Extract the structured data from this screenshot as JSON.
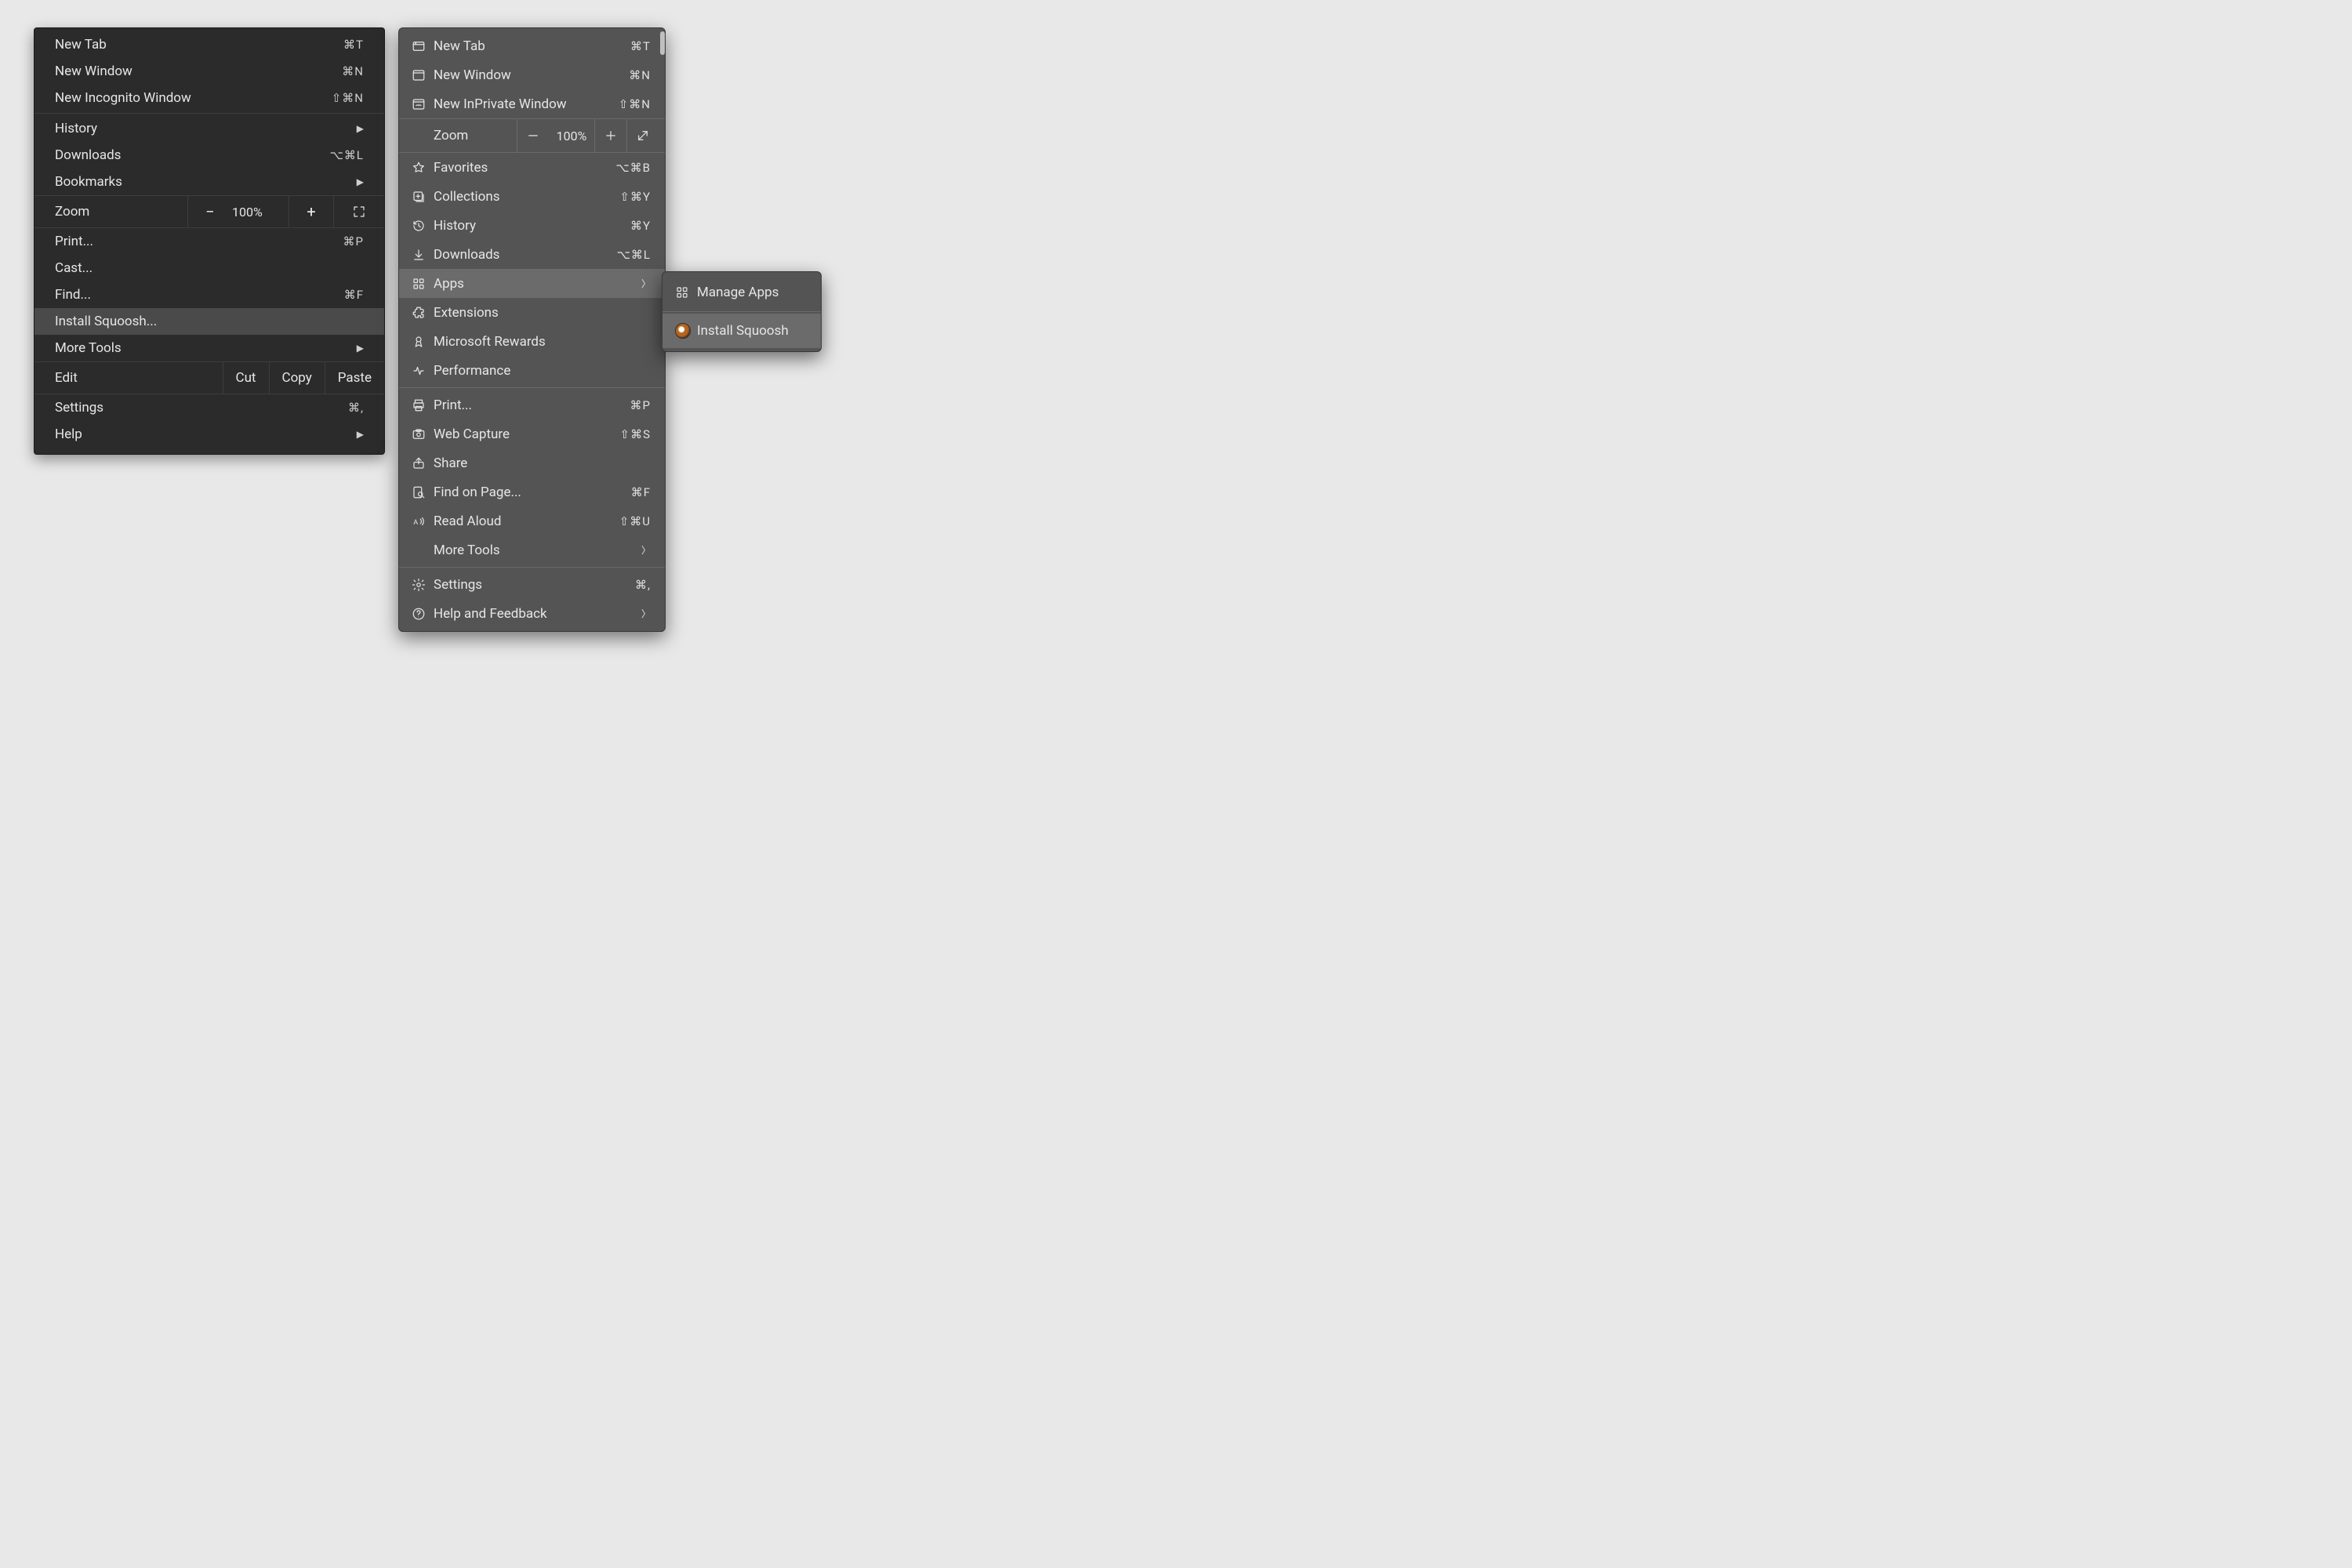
{
  "chrome_menu": {
    "sections": {
      "top": [
        {
          "label": "New Tab",
          "shortcut": "⌘T"
        },
        {
          "label": "New Window",
          "shortcut": "⌘N"
        },
        {
          "label": "New Incognito Window",
          "shortcut": "⇧⌘N"
        }
      ],
      "nav": [
        {
          "label": "History",
          "arrow": true
        },
        {
          "label": "Downloads",
          "shortcut": "⌥⌘L"
        },
        {
          "label": "Bookmarks",
          "arrow": true
        }
      ],
      "zoom": {
        "label": "Zoom",
        "value": "100%"
      },
      "mid": [
        {
          "label": "Print...",
          "shortcut": "⌘P"
        },
        {
          "label": "Cast..."
        },
        {
          "label": "Find...",
          "shortcut": "⌘F"
        },
        {
          "label": "Install Squoosh...",
          "highlight": true
        },
        {
          "label": "More Tools",
          "arrow": true
        }
      ],
      "edit": {
        "label": "Edit",
        "cut": "Cut",
        "copy": "Copy",
        "paste": "Paste"
      },
      "bottom": [
        {
          "label": "Settings",
          "shortcut": "⌘,"
        },
        {
          "label": "Help",
          "arrow": true
        }
      ]
    }
  },
  "edge_menu": {
    "sections": {
      "top": [
        {
          "icon": "new-tab-icon",
          "label": "New Tab",
          "shortcut": "⌘T"
        },
        {
          "icon": "new-window-icon",
          "label": "New Window",
          "shortcut": "⌘N"
        },
        {
          "icon": "new-inprivate-icon",
          "label": "New InPrivate Window",
          "shortcut": "⇧⌘N"
        }
      ],
      "zoom": {
        "label": "Zoom",
        "value": "100%"
      },
      "middle1": [
        {
          "icon": "favorites-icon",
          "label": "Favorites",
          "shortcut": "⌥⌘B"
        },
        {
          "icon": "collections-icon",
          "label": "Collections",
          "shortcut": "⇧⌘Y"
        },
        {
          "icon": "history-icon",
          "label": "History",
          "shortcut": "⌘Y"
        },
        {
          "icon": "downloads-icon",
          "label": "Downloads",
          "shortcut": "⌥⌘L"
        },
        {
          "icon": "apps-icon",
          "label": "Apps",
          "arrow": true,
          "highlight": true
        },
        {
          "icon": "extensions-icon",
          "label": "Extensions"
        },
        {
          "icon": "rewards-icon",
          "label": "Microsoft Rewards"
        },
        {
          "icon": "performance-icon",
          "label": "Performance"
        }
      ],
      "middle2": [
        {
          "icon": "print-icon",
          "label": "Print...",
          "shortcut": "⌘P"
        },
        {
          "icon": "webcapture-icon",
          "label": "Web Capture",
          "shortcut": "⇧⌘S"
        },
        {
          "icon": "share-icon",
          "label": "Share"
        },
        {
          "icon": "find-icon",
          "label": "Find on Page...",
          "shortcut": "⌘F"
        },
        {
          "icon": "readaloud-icon",
          "label": "Read Aloud",
          "shortcut": "⇧⌘U"
        },
        {
          "icon": "",
          "label": "More Tools",
          "arrow": true
        }
      ],
      "bottom": [
        {
          "icon": "settings-icon",
          "label": "Settings",
          "shortcut": "⌘,"
        },
        {
          "icon": "help-icon",
          "label": "Help and Feedback",
          "arrow": true
        }
      ]
    }
  },
  "edge_submenu": {
    "items": [
      {
        "icon": "apps-icon",
        "label": "Manage Apps"
      },
      {
        "icon": "squoosh-icon",
        "label": "Install Squoosh",
        "highlight": true
      }
    ]
  }
}
